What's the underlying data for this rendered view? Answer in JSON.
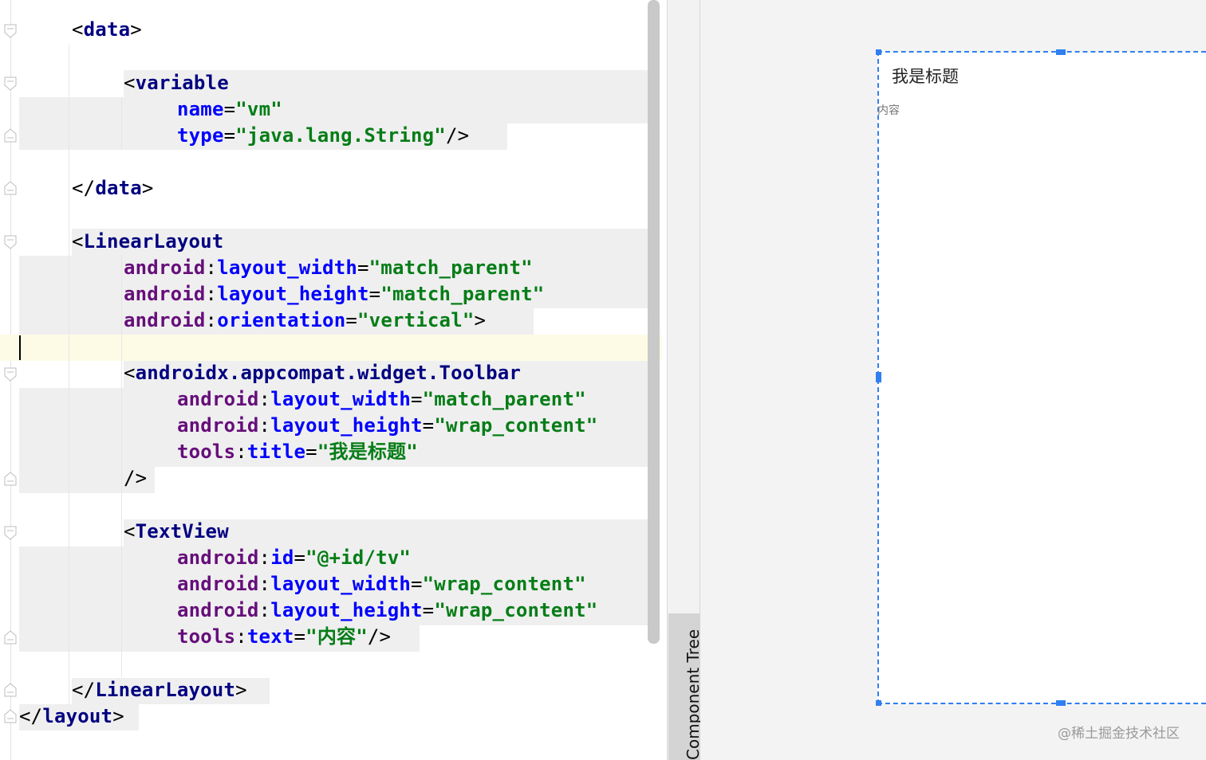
{
  "editor": {
    "lines": [
      {
        "parts": [
          [
            "p",
            "<"
          ],
          [
            "tag",
            "data"
          ],
          [
            "p",
            ">"
          ]
        ]
      },
      {
        "parts": [
          [
            "p",
            "<"
          ],
          [
            "tag",
            "variable"
          ]
        ]
      },
      {
        "parts": [
          [
            "attr",
            "name"
          ],
          [
            "eq",
            "="
          ],
          [
            "val",
            "\"vm\""
          ]
        ]
      },
      {
        "parts": [
          [
            "attr",
            "type"
          ],
          [
            "eq",
            "="
          ],
          [
            "val",
            "\"java.lang.String\""
          ],
          [
            "p",
            "/>"
          ]
        ]
      },
      {
        "parts": [
          [
            "p",
            "</"
          ],
          [
            "tag",
            "data"
          ],
          [
            "p",
            ">"
          ]
        ]
      },
      {
        "parts": [
          [
            "p",
            "<"
          ],
          [
            "tag",
            "LinearLayout"
          ]
        ]
      },
      {
        "parts": [
          [
            "ns",
            "android"
          ],
          [
            "p",
            ":"
          ],
          [
            "attr",
            "layout_width"
          ],
          [
            "eq",
            "="
          ],
          [
            "val",
            "\"match_parent\""
          ]
        ]
      },
      {
        "parts": [
          [
            "ns",
            "android"
          ],
          [
            "p",
            ":"
          ],
          [
            "attr",
            "layout_height"
          ],
          [
            "eq",
            "="
          ],
          [
            "val",
            "\"match_parent\""
          ]
        ]
      },
      {
        "parts": [
          [
            "ns",
            "android"
          ],
          [
            "p",
            ":"
          ],
          [
            "attr",
            "orientation"
          ],
          [
            "eq",
            "="
          ],
          [
            "val",
            "\"vertical\""
          ],
          [
            "p",
            ">"
          ]
        ]
      },
      {
        "parts": [
          [
            "p",
            "<"
          ],
          [
            "tag",
            "androidx.appcompat.widget.Toolbar"
          ]
        ]
      },
      {
        "parts": [
          [
            "ns",
            "android"
          ],
          [
            "p",
            ":"
          ],
          [
            "attr",
            "layout_width"
          ],
          [
            "eq",
            "="
          ],
          [
            "val",
            "\"match_parent\""
          ]
        ]
      },
      {
        "parts": [
          [
            "ns",
            "android"
          ],
          [
            "p",
            ":"
          ],
          [
            "attr",
            "layout_height"
          ],
          [
            "eq",
            "="
          ],
          [
            "val",
            "\"wrap_content\""
          ]
        ]
      },
      {
        "parts": [
          [
            "ns",
            "tools"
          ],
          [
            "p",
            ":"
          ],
          [
            "attr",
            "title"
          ],
          [
            "eq",
            "="
          ],
          [
            "val",
            "\"我是标题\""
          ]
        ]
      },
      {
        "parts": [
          [
            "p",
            "/>"
          ]
        ]
      },
      {
        "parts": [
          [
            "p",
            "<"
          ],
          [
            "tag",
            "TextView"
          ]
        ]
      },
      {
        "parts": [
          [
            "ns",
            "android"
          ],
          [
            "p",
            ":"
          ],
          [
            "attr",
            "id"
          ],
          [
            "eq",
            "="
          ],
          [
            "val",
            "\"@+id/tv\""
          ]
        ]
      },
      {
        "parts": [
          [
            "ns",
            "android"
          ],
          [
            "p",
            ":"
          ],
          [
            "attr",
            "layout_width"
          ],
          [
            "eq",
            "="
          ],
          [
            "val",
            "\"wrap_content\""
          ]
        ]
      },
      {
        "parts": [
          [
            "ns",
            "android"
          ],
          [
            "p",
            ":"
          ],
          [
            "attr",
            "layout_height"
          ],
          [
            "eq",
            "="
          ],
          [
            "val",
            "\"wrap_content\""
          ]
        ]
      },
      {
        "parts": [
          [
            "ns",
            "tools"
          ],
          [
            "p",
            ":"
          ],
          [
            "attr",
            "text"
          ],
          [
            "eq",
            "="
          ],
          [
            "val",
            "\"内容\""
          ],
          [
            "p",
            "/>"
          ]
        ]
      },
      {
        "parts": [
          [
            "p",
            "</"
          ],
          [
            "tag",
            "LinearLayout"
          ],
          [
            "p",
            ">"
          ]
        ]
      },
      {
        "parts": [
          [
            "p",
            "</"
          ],
          [
            "tag",
            "layout"
          ],
          [
            "p",
            ">"
          ]
        ]
      }
    ]
  },
  "side_panel": {
    "component_tree_label": "Component Tree"
  },
  "preview": {
    "toolbar_title": "我是标题",
    "textview_text": "内容",
    "accent_color": "#2f7ff0"
  },
  "watermark": "@稀土掘金技术社区"
}
